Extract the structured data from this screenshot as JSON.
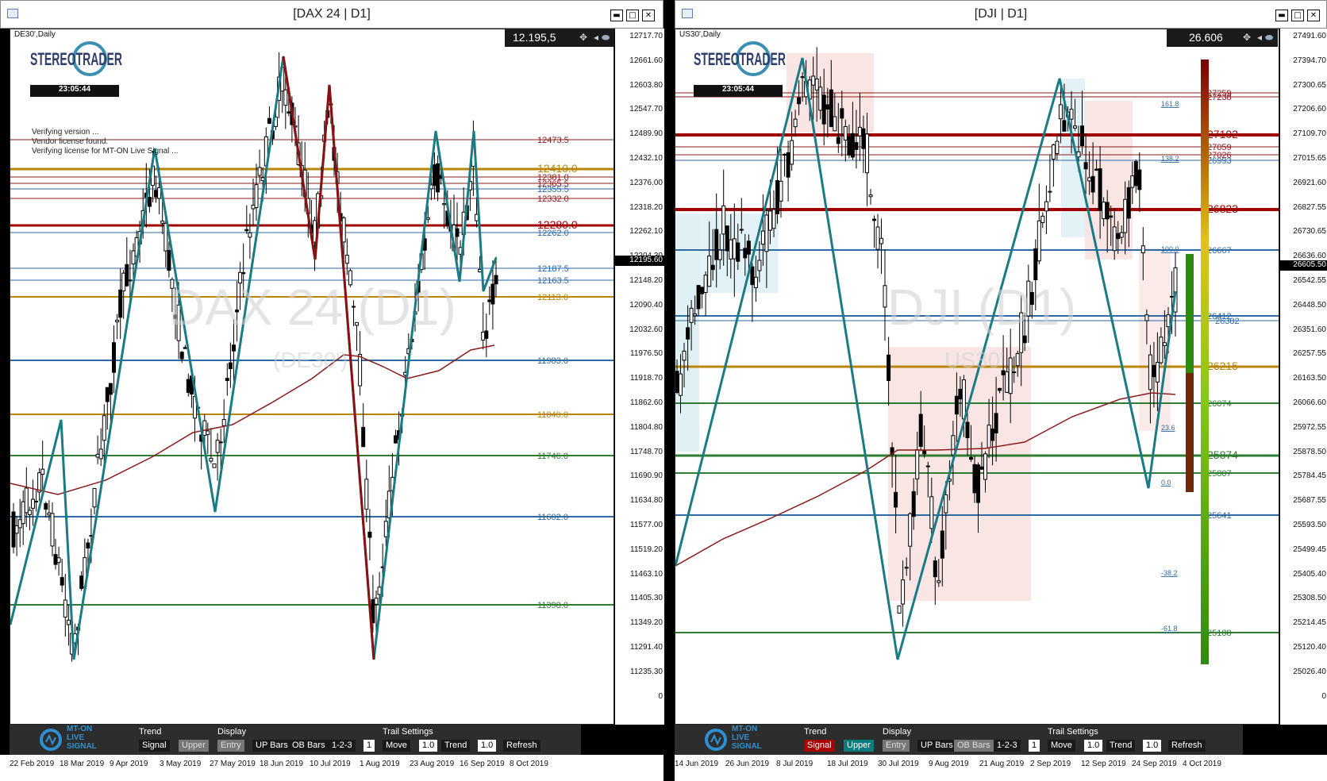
{
  "windows": [
    {
      "id": "dax",
      "title": "[DAX 24 | D1]",
      "symbol": "DE30',Daily",
      "price_box": "12.195,5",
      "current_price_tag": "12195.60",
      "clock": "23:05:44",
      "logo": "STEREOTRADER",
      "verify_lines": [
        "Verifying version ...",
        "Vendor license found.",
        "Verifying license for MT-ON Live Signal ..."
      ],
      "watermark": "DAX 24 (D1)",
      "watermark_sub": "(DE30')",
      "price_axis": [
        "12717.70",
        "12661.60",
        "12603.80",
        "12547.70",
        "12489.90",
        "12432.10",
        "12376.00",
        "12318.20",
        "12262.10",
        "12204.30",
        "12148.20",
        "12090.40",
        "12032.60",
        "11976.50",
        "11918.70",
        "11862.60",
        "11804.80",
        "11748.70",
        "11690.90",
        "11634.80",
        "11577.00",
        "11519.20",
        "11463.10",
        "11405.30",
        "11349.20",
        "11291.40",
        "11235.30",
        "0"
      ],
      "levels": [
        {
          "label": "12473.5",
          "color": "#8b1a1a"
        },
        {
          "label": "12410.0",
          "color": "#b8860b"
        },
        {
          "label": "12381.0",
          "color": "#8b1a1a"
        },
        {
          "label": "12365.5",
          "color": "#8b1a1a"
        },
        {
          "label": "12355.5",
          "color": "#2e6aa3"
        },
        {
          "label": "12332.0",
          "color": "#8b1a1a"
        },
        {
          "label": "12280.0",
          "color": "#a00000"
        },
        {
          "label": "12262.0",
          "color": "#2e6aa3"
        },
        {
          "label": "12187.5",
          "color": "#2e6aa3"
        },
        {
          "label": "12163.5",
          "color": "#2e6aa3"
        },
        {
          "label": "12113.0",
          "color": "#b8860b"
        },
        {
          "label": "11983.0",
          "color": "#2e6aa3"
        },
        {
          "label": "11840.0",
          "color": "#b8860b"
        },
        {
          "label": "11746.0",
          "color": "#2e7d32"
        },
        {
          "label": "11602.0",
          "color": "#2e6aa3"
        },
        {
          "label": "11398.0",
          "color": "#2e7d32"
        }
      ],
      "dates": [
        "22 Feb 2019",
        "18 Mar 2019",
        "9 Apr 2019",
        "3 May 2019",
        "27 May 2019",
        "18 Jun 2019",
        "10 Jul 2019",
        "1 Aug 2019",
        "23 Aug 2019",
        "16 Sep 2019",
        "8 Oct 2019"
      ]
    },
    {
      "id": "dji",
      "title": "[DJI | D1]",
      "symbol": "US30',Daily",
      "price_box": "26.606",
      "current_price_tag": "26605.50",
      "clock": "23:05:44",
      "logo": "STEREOTRADER",
      "watermark": "DJI (D1)",
      "watermark_sub": "US30'",
      "price_axis": [
        "27491.60",
        "27394.70",
        "27300.65",
        "27206.60",
        "27109.70",
        "27015.65",
        "26921.60",
        "26827.55",
        "26730.65",
        "26636.60",
        "26542.55",
        "26448.50",
        "26351.60",
        "26257.55",
        "26163.50",
        "26066.60",
        "25972.55",
        "25878.50",
        "25784.45",
        "25687.55",
        "25593.50",
        "25499.45",
        "25405.40",
        "25308.50",
        "25214.45",
        "25120.40",
        "25026.40",
        "0"
      ],
      "levels": [
        {
          "label": "27259",
          "color": "#8b1a1a"
        },
        {
          "label": "27238",
          "color": "#8b1a1a"
        },
        {
          "label": "27102",
          "color": "#a00000"
        },
        {
          "label": "27059",
          "color": "#8b1a1a"
        },
        {
          "label": "27026",
          "color": "#8b1a1a"
        },
        {
          "label": "26993",
          "color": "#2e6aa3"
        },
        {
          "label": "26823",
          "color": "#a00000"
        },
        {
          "label": "26667",
          "color": "#2e6aa3"
        },
        {
          "label": "26412",
          "color": "#2e6aa3"
        },
        {
          "label": "26382",
          "color": "#2e6aa3"
        },
        {
          "label": "26215",
          "color": "#b8860b"
        },
        {
          "label": "26074",
          "color": "#2e7d32"
        },
        {
          "label": "25874",
          "color": "#2e7d32"
        },
        {
          "label": "25807",
          "color": "#2e7d32"
        },
        {
          "label": "25641",
          "color": "#2e6aa3"
        },
        {
          "label": "25188",
          "color": "#2e7d32"
        }
      ],
      "fib_labels": [
        "161.8",
        "138.2",
        "100.0",
        "23.6",
        "0.0",
        "-38.2",
        "-61.8"
      ],
      "dates": [
        "14 Jun 2019",
        "26 Jun 2019",
        "8 Jul 2019",
        "18 Jul 2019",
        "30 Jul 2019",
        "9 Aug 2019",
        "21 Aug 2019",
        "2 Sep 2019",
        "12 Sep 2019",
        "24 Sep 2019",
        "4 Oct 2019"
      ]
    }
  ],
  "toolbar": {
    "logo_lines": [
      "MT-ON",
      "LIVE",
      "SIGNAL"
    ],
    "trend_label": "Trend",
    "trend_signal": "Signal",
    "trend_upper": "Upper",
    "display_label": "Display",
    "display_entry": "Entry",
    "display_up_bars": "UP Bars",
    "display_ob_bars": "OB Bars",
    "display_123": "1-2-3",
    "display_one": "1",
    "trail_label": "Trail Settings",
    "trail_move": "Move",
    "trail_move_val": "1.0",
    "trail_trend": "Trend",
    "trail_trend_val": "1.0",
    "refresh": "Refresh"
  }
}
